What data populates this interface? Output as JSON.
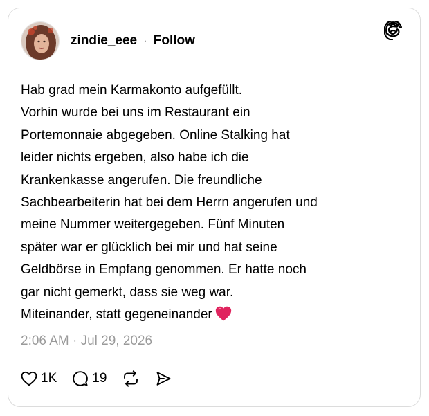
{
  "post": {
    "username": "zindie_eee",
    "separator": "·",
    "follow_label": "Follow",
    "text_lines": [
      "Hab grad mein Karmakonto aufgefüllt.",
      "Vorhin wurde bei uns im Restaurant ein",
      "Portemonnaie abgegeben. Online Stalking hat",
      "leider nichts ergeben, also habe ich die",
      "Krankenkasse angerufen. Die freundliche",
      "Sachbearbeiterin hat bei dem Herrn angerufen und",
      "meine Nummer weitergegeben. Fünf Minuten",
      "später war er glücklich bei mir und hat seine",
      "Geldbörse in Empfang genommen. Er hatte noch",
      "gar nicht gemerkt, dass sie weg war.",
      "Miteinander, statt gegeneinander"
    ],
    "emoji": "red-heart-emoji",
    "timestamp": "2:06 AM · Jul 29, 2026"
  },
  "actions": {
    "like_count": "1K",
    "reply_count": "19"
  },
  "icons": {
    "logo": "threads-logo-icon",
    "like": "heart-outline-icon",
    "reply": "speech-bubble-icon",
    "repost": "repost-arrows-icon",
    "share": "send-paper-plane-icon"
  },
  "colors": {
    "text": "#000000",
    "muted": "#9a9a9a",
    "border": "#dcdcdc",
    "heart": "#e0245e"
  }
}
